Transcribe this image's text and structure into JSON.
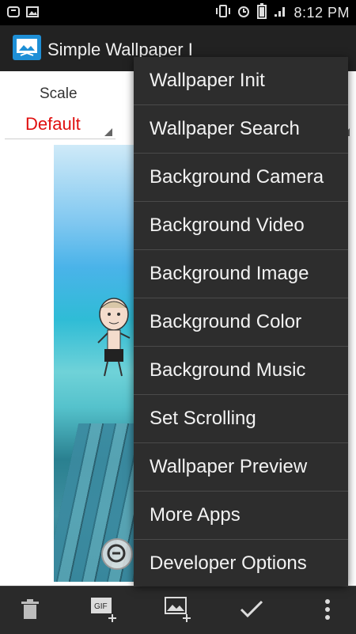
{
  "status_bar": {
    "time": "8:12 PM",
    "icons": [
      "notification-icon",
      "image-icon",
      "vibrate-icon",
      "alarm-icon",
      "battery-icon",
      "signal-icon"
    ]
  },
  "action_bar": {
    "title": "Simple Wallpaper I",
    "app_icon": "wallpaper-app-icon"
  },
  "content": {
    "scale_label": "Scale",
    "scale_value": "Default"
  },
  "menu": {
    "items": [
      {
        "label": "Wallpaper Init"
      },
      {
        "label": "Wallpaper Search"
      },
      {
        "label": "Background Camera"
      },
      {
        "label": "Background Video"
      },
      {
        "label": "Background Image"
      },
      {
        "label": "Background Color"
      },
      {
        "label": "Background Music"
      },
      {
        "label": "Set Scrolling"
      },
      {
        "label": "Wallpaper Preview"
      },
      {
        "label": "More Apps"
      },
      {
        "label": "Developer Options"
      }
    ]
  },
  "bottom_bar": {
    "buttons": [
      "trash-icon",
      "add-gif-icon",
      "add-image-icon",
      "check-icon",
      "overflow-menu-icon"
    ],
    "gif_badge": "GIF"
  },
  "colors": {
    "accent_red": "#e01010",
    "menu_bg": "#2d2d2d",
    "actionbar_bg": "#222222"
  }
}
